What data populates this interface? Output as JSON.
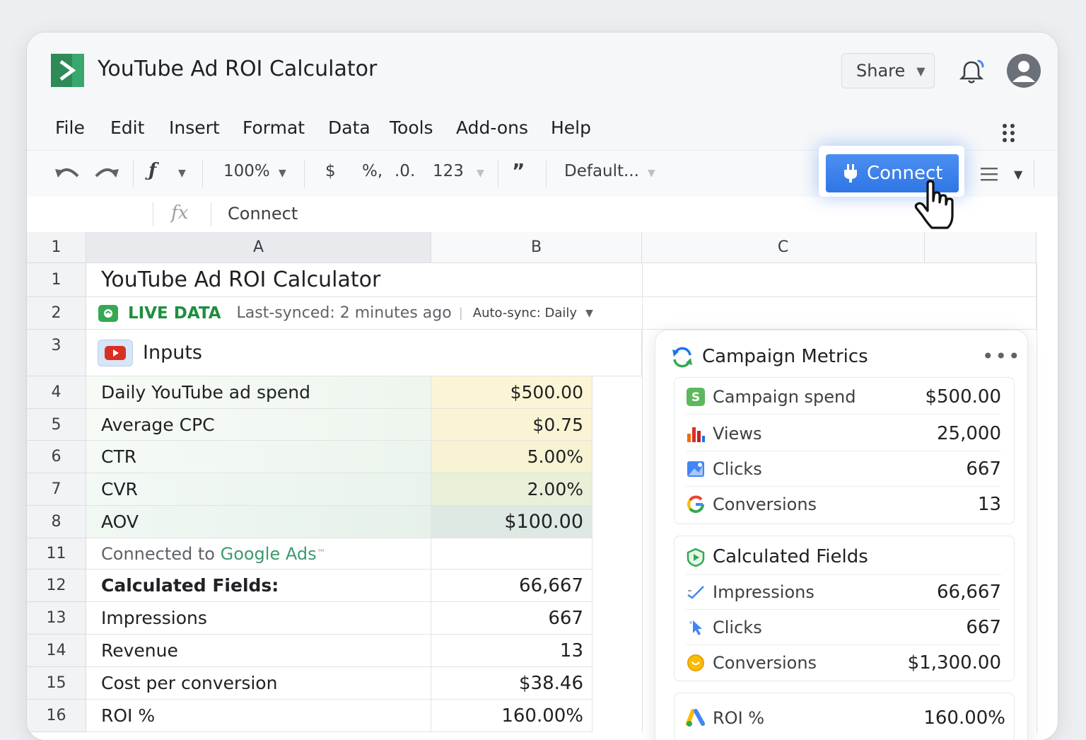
{
  "app": {
    "title": "YouTube Ad ROI Calculator"
  },
  "header": {
    "share_label": "Share"
  },
  "menu": [
    "File",
    "Edit",
    "Insert",
    "Format",
    "Data",
    "Tools",
    "Add-ons",
    "Help"
  ],
  "toolbar": {
    "zoom": "100%",
    "currency": "$",
    "percent": "%,",
    "decimal": ".0.",
    "number_format": "123",
    "quote": "”",
    "font": "Default...",
    "connect_label": "Connect"
  },
  "formula_bar": {
    "fx": "fx",
    "value": "Connect"
  },
  "grid": {
    "corner_label": "1",
    "columns": [
      "A",
      "B",
      "C"
    ],
    "title_row": {
      "row": "1",
      "text": "YouTube Ad ROI Calculator"
    },
    "live_row": {
      "row": "2",
      "live_label": "LIVE DATA",
      "synced": "Last-synced: 2 minutes ago",
      "autosync": "Auto-sync: Daily"
    },
    "inputs_row": {
      "row": "3",
      "label": "Inputs"
    },
    "inputs": [
      {
        "row": "4",
        "label": "Daily YouTube ad spend",
        "value": "$500.00"
      },
      {
        "row": "5",
        "label": "Average CPC",
        "value": "$0.75"
      },
      {
        "row": "6",
        "label": "CTR",
        "value": "5.00%"
      },
      {
        "row": "7",
        "label": "CVR",
        "value": "2.00%"
      },
      {
        "row": "8",
        "label": "AOV",
        "value": "$100.00"
      }
    ],
    "connected_row": {
      "row": "11",
      "prefix": "Connected to ",
      "service": "Google Ads",
      "tm": "™"
    },
    "calculated": [
      {
        "row": "12",
        "label": "Calculated Fields:",
        "value": "66,667",
        "bold": true
      },
      {
        "row": "13",
        "label": "Impressions",
        "value": "667"
      },
      {
        "row": "14",
        "label": "Revenue",
        "value": "13"
      },
      {
        "row": "15",
        "label": "Cost per conversion",
        "value": "$38.46"
      },
      {
        "row": "16",
        "label": "ROI %",
        "value": "160.00%"
      }
    ]
  },
  "metrics_panel": {
    "title": "Campaign Metrics",
    "more": "•••",
    "campaign": [
      {
        "label": "Campaign spend",
        "value": "$500.00",
        "icon": "dollar-icon"
      },
      {
        "label": "Views",
        "value": "25,000",
        "icon": "bar-chart-icon"
      },
      {
        "label": "Clicks",
        "value": "667",
        "icon": "image-chart-icon"
      },
      {
        "label": "Conversions",
        "value": "13",
        "icon": "google-icon"
      }
    ],
    "calculated_title": "Calculated Fields",
    "calculated": [
      {
        "label": "Impressions",
        "value": "66,667",
        "icon": "check-trend-icon"
      },
      {
        "label": "Clicks",
        "value": "667",
        "icon": "pointer-icon"
      },
      {
        "label": "Conversions",
        "value": "$1,300.00",
        "icon": "coin-icon"
      }
    ],
    "roi": {
      "label": "ROI %",
      "value": "160.00%",
      "icon": "google-ads-icon"
    }
  },
  "colors": {
    "accent": "#2f76e6",
    "brand_green": "#2e8b57",
    "live_green": "#1e8e3e"
  }
}
